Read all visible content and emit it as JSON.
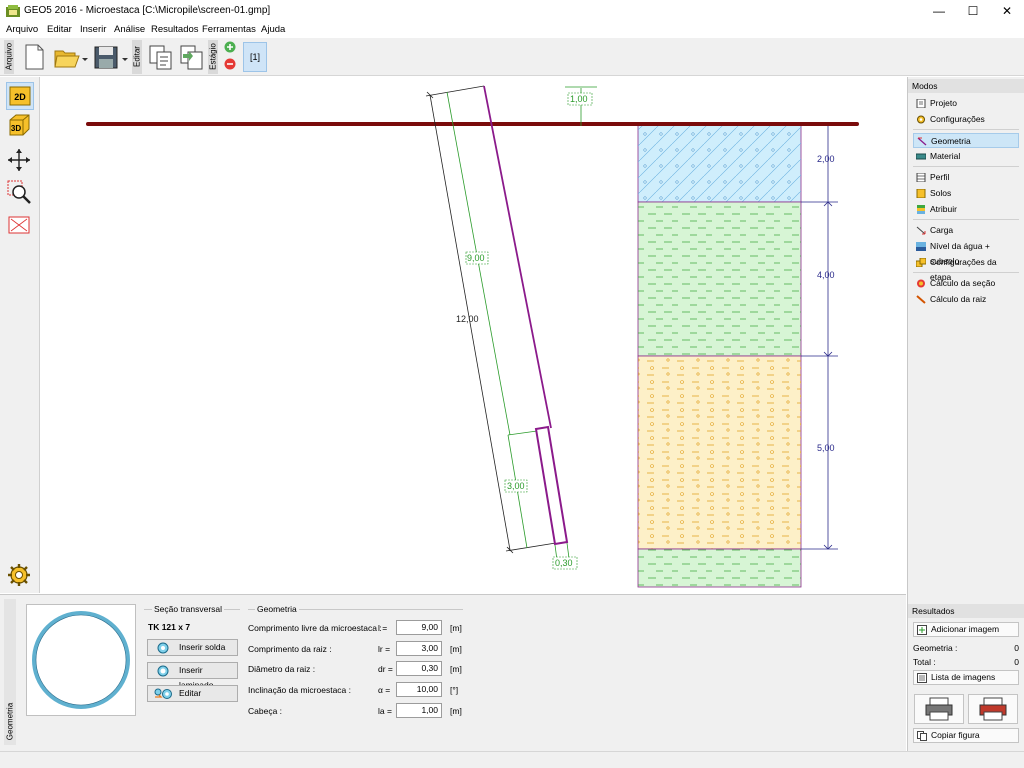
{
  "window": {
    "title": "GEO5 2016 - Microestaca [C:\\Micropile\\screen-01.gmp]",
    "minimize_symbol": "—",
    "maximize_symbol": "☐",
    "close_symbol": "✕"
  },
  "menu": [
    "Arquivo",
    "Editar",
    "Inserir",
    "Análise",
    "Resultados",
    "Ferramentas",
    "Ajuda"
  ],
  "toolbar": {
    "file_label": "Arquivo",
    "edit_label": "Editar",
    "stage_label": "Estágio",
    "stage_button": "[1]"
  },
  "leftbar": {
    "view2d": "2D",
    "view3d": "3D"
  },
  "drawing": {
    "dims": {
      "inclination_offset": "1,00",
      "free_length": "9,00",
      "total_length": "12,00",
      "root_length": "3,00",
      "root_diameter": "0,30"
    },
    "layers": [
      {
        "thickness": "2,00",
        "color": "#cfeefc",
        "hatch": "#6ab2e0"
      },
      {
        "thickness": "4,00",
        "color": "#d7f5d5",
        "hatch": "#3ea83e"
      },
      {
        "thickness": "5,00",
        "color": "#fdf0c8",
        "hatch": "#e0a020"
      },
      {
        "thickness": "",
        "color": "#d7f5d5",
        "hatch": "#3ea83e"
      }
    ],
    "colors": {
      "ground": "#7a0b0b",
      "pile": "#8b1a8b",
      "dimension_green": "#2a9b2a",
      "dimension_blue": "#2a2a8a"
    }
  },
  "modes": {
    "header": "Modos",
    "items": [
      {
        "label": "Projeto",
        "icon": "document-icon",
        "active": false
      },
      {
        "label": "Configurações",
        "icon": "gear-icon",
        "active": false
      },
      {
        "label": "Geometria",
        "icon": "geometry-icon",
        "active": true
      },
      {
        "label": "Material",
        "icon": "material-icon",
        "active": false
      },
      {
        "label": "Perfil",
        "icon": "profile-icon",
        "active": false
      },
      {
        "label": "Solos",
        "icon": "soils-icon",
        "active": false
      },
      {
        "label": "Atribuir",
        "icon": "assign-icon",
        "active": false
      },
      {
        "label": "Carga",
        "icon": "load-icon",
        "active": false
      },
      {
        "label": "Nível da água + subsolo",
        "icon": "water-icon",
        "active": false
      },
      {
        "label": "Configurações da etapa",
        "icon": "stage-settings-icon",
        "active": false
      },
      {
        "label": "Cálculo da seção",
        "icon": "section-calc-icon",
        "active": false
      },
      {
        "label": "Cálculo da raiz",
        "icon": "root-calc-icon",
        "active": false
      }
    ]
  },
  "results": {
    "header": "Resultados",
    "add_image": "Adicionar imagem",
    "rows": [
      {
        "label": "Geometria :",
        "value": "0"
      },
      {
        "label": "Total :",
        "value": "0"
      }
    ],
    "image_list": "Lista de imagens",
    "copy_figure": "Copiar figura"
  },
  "bottom": {
    "side_tab": "Geometria",
    "cross_section_title": "Seção transversal",
    "cross_section_name": "TK 121 x 7",
    "buttons": [
      "Inserir solda",
      "Inserir laminado",
      "Editar"
    ],
    "geometry_title": "Geometria",
    "fields": [
      {
        "label": "Comprimento livre da microestaca :",
        "symbol": "l =",
        "value": "9,00",
        "unit": "[m]"
      },
      {
        "label": "Comprimento da raiz :",
        "symbol": "lr =",
        "value": "3,00",
        "unit": "[m]"
      },
      {
        "label": "Diâmetro da raiz :",
        "symbol": "dr =",
        "value": "0,30",
        "unit": "[m]"
      },
      {
        "label": "Inclinação da microestaca :",
        "symbol": "α =",
        "value": "10,00",
        "unit": "[°]"
      },
      {
        "label": "Cabeça :",
        "symbol": "la =",
        "value": "1,00",
        "unit": "[m]"
      }
    ]
  }
}
